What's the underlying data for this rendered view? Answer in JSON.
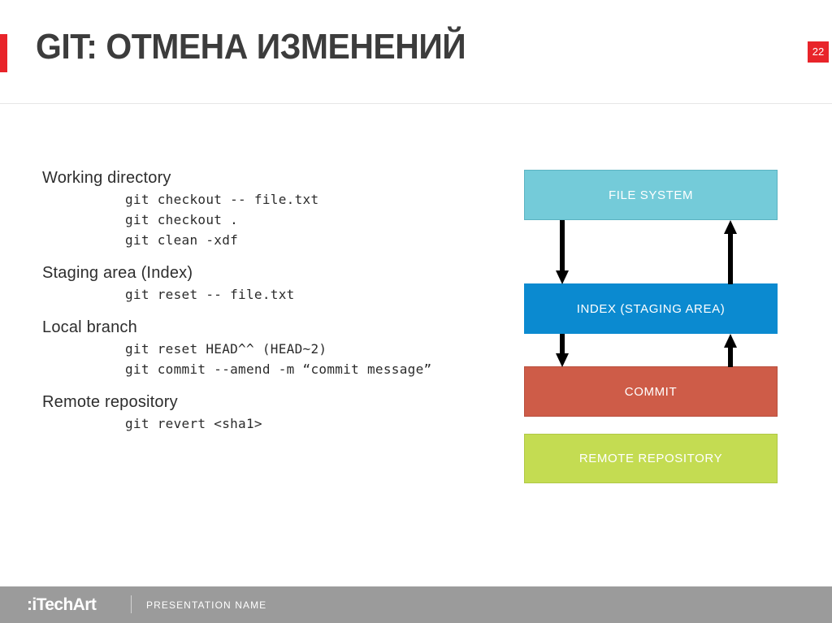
{
  "header": {
    "title": "GIT: ОТМЕНА ИЗМЕНЕНИЙ",
    "slide_number": "22",
    "accent_color": "#e8242a",
    "title_color": "#3c3c3c"
  },
  "content": {
    "sections": [
      {
        "heading": "Working directory",
        "commands": [
          "git checkout -- file.txt",
          "git checkout .",
          "git clean -xdf"
        ]
      },
      {
        "heading": "Staging area (Index)",
        "commands": [
          "git reset -- file.txt"
        ]
      },
      {
        "heading": "Local branch",
        "commands": [
          "git reset HEAD^^ (HEAD~2)",
          "git commit --amend -m “commit message”"
        ]
      },
      {
        "heading": "Remote repository",
        "commands": [
          "git revert <sha1>"
        ]
      }
    ]
  },
  "diagram": {
    "boxes": [
      {
        "label": "FILE SYSTEM",
        "color": "#74cbd9"
      },
      {
        "label": "INDEX (STAGING AREA)",
        "color": "#0b8ad0"
      },
      {
        "label": "COMMIT",
        "color": "#ce5c48"
      },
      {
        "label": "REMOTE REPOSITORY",
        "color": "#c4dc52"
      }
    ],
    "arrows": [
      {
        "name": "file-system-to-index",
        "direction": "down"
      },
      {
        "name": "index-to-file-system",
        "direction": "up"
      },
      {
        "name": "index-to-commit",
        "direction": "down"
      },
      {
        "name": "commit-to-index",
        "direction": "up"
      }
    ],
    "arrow_color": "#000000"
  },
  "footer": {
    "logo": ":iTechArt",
    "presentation_name": "PRESENTATION NAME",
    "background_color": "#9b9b9b"
  }
}
